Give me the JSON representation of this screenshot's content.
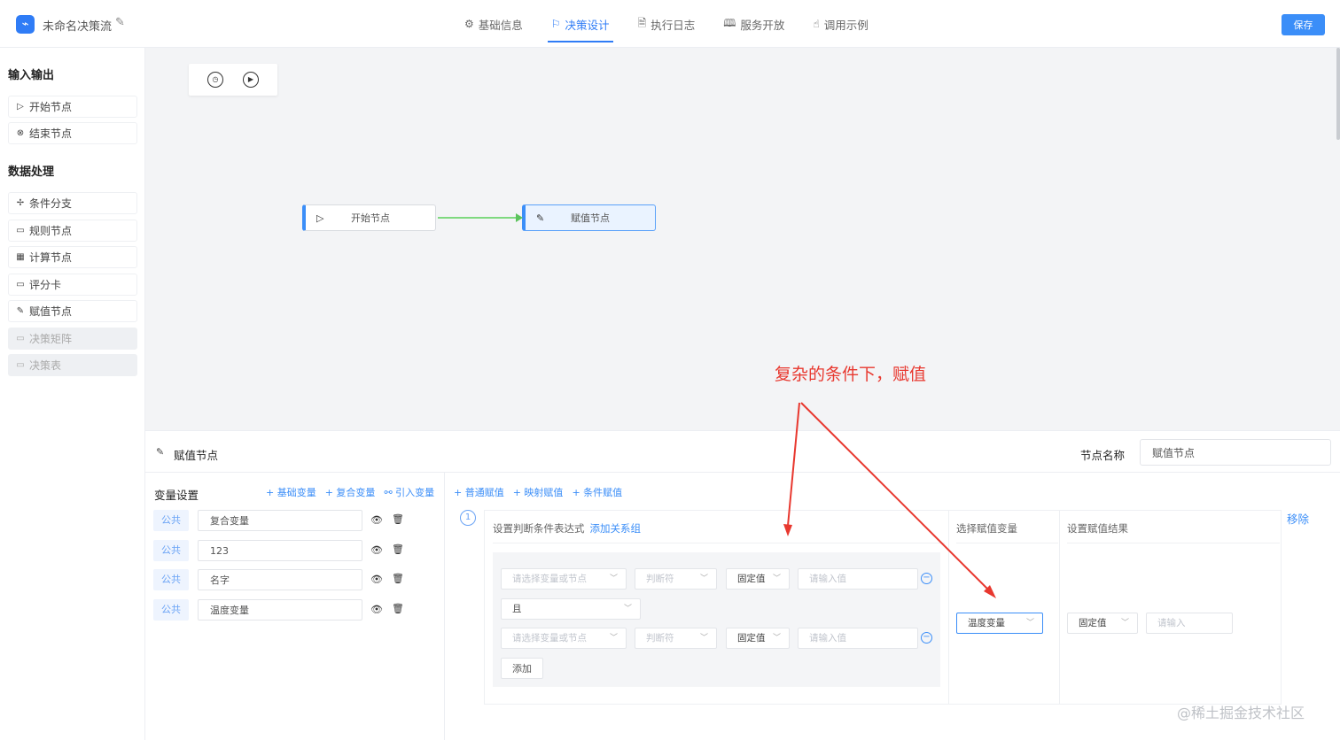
{
  "header": {
    "logo_glyph": "⌁",
    "title": "未命名决策流",
    "tabs": [
      {
        "label": "基础信息",
        "icon": "⚙"
      },
      {
        "label": "决策设计",
        "icon": "⚐"
      },
      {
        "label": "执行日志",
        "icon": "🗎"
      },
      {
        "label": "服务开放",
        "icon": "🕮"
      },
      {
        "label": "调用示例",
        "icon": "☝"
      }
    ],
    "save_label": "保存"
  },
  "sidebar": {
    "section_io": "输入输出",
    "io_items": [
      {
        "label": "开始节点",
        "icon": "▷"
      },
      {
        "label": "结束节点",
        "icon": "⊗"
      }
    ],
    "section_data": "数据处理",
    "data_items": [
      {
        "label": "条件分支",
        "icon": "✢"
      },
      {
        "label": "规则节点",
        "icon": "▭"
      },
      {
        "label": "计算节点",
        "icon": "▦"
      },
      {
        "label": "评分卡",
        "icon": "▭"
      },
      {
        "label": "赋值节点",
        "icon": "✎"
      },
      {
        "label": "决策矩阵",
        "icon": "▭"
      },
      {
        "label": "决策表",
        "icon": "▭"
      }
    ]
  },
  "canvas": {
    "toolbar": [
      "◷",
      "▶"
    ],
    "nodes": [
      {
        "label": "开始节点",
        "icon": "▷"
      },
      {
        "label": "赋值节点",
        "icon": "✎"
      }
    ]
  },
  "panel": {
    "title": "赋值节点",
    "name_label": "节点名称",
    "name_value": "赋值节点",
    "variables": {
      "title": "变量设置",
      "actions": [
        "+ 基础变量",
        "+ 复合变量",
        "⚯ 引入变量"
      ],
      "rows": [
        {
          "tag": "公共",
          "value": "复合变量"
        },
        {
          "tag": "公共",
          "value": "123"
        },
        {
          "tag": "公共",
          "value": "名字"
        },
        {
          "tag": "公共",
          "value": "温度变量"
        }
      ]
    },
    "assign": {
      "actions": [
        "+ 普通赋值",
        "+ 映射赋值",
        "+ 条件赋值"
      ],
      "index": "1",
      "cond_header": "设置判断条件表达式",
      "add_group": "添加关系组",
      "var_header": "选择赋值变量",
      "result_header": "设置赋值结果",
      "remove": "移除",
      "rows": [
        {
          "var": "请选择变量或节点",
          "op": "判断符",
          "type": "固定值",
          "value": "请输入值"
        },
        {
          "var": "请选择变量或节点",
          "op": "判断符",
          "type": "固定值",
          "value": "请输入值"
        }
      ],
      "logic": "且",
      "add_label": "添加",
      "selected_var": "温度变量",
      "result_type": "固定值",
      "result_placeholder": "请输入"
    }
  },
  "annotation": "复杂的条件下，赋值",
  "watermark": "@稀土掘金技术社区"
}
